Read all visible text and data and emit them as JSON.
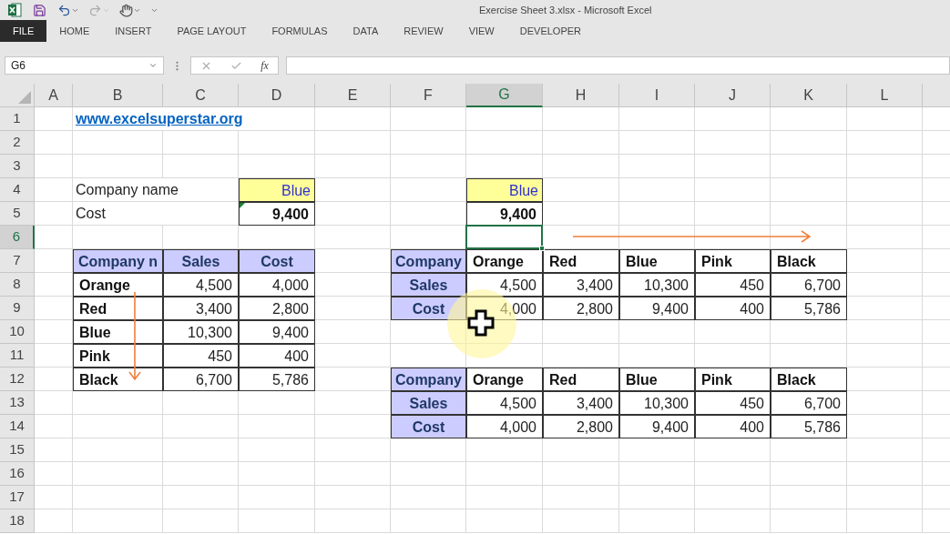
{
  "window": {
    "title": "Exercise Sheet 3.xlsx - Microsoft Excel"
  },
  "ribbon_tabs": [
    {
      "label": "FILE",
      "selected": true
    },
    {
      "label": "HOME",
      "selected": false
    },
    {
      "label": "INSERT",
      "selected": false
    },
    {
      "label": "PAGE LAYOUT",
      "selected": false
    },
    {
      "label": "FORMULAS",
      "selected": false
    },
    {
      "label": "DATA",
      "selected": false
    },
    {
      "label": "REVIEW",
      "selected": false
    },
    {
      "label": "VIEW",
      "selected": false
    },
    {
      "label": "DEVELOPER",
      "selected": false
    }
  ],
  "formula_bar": {
    "name_box": "G6",
    "function_label": "fx"
  },
  "columns": [
    {
      "label": "A",
      "selected": false
    },
    {
      "label": "B",
      "selected": false
    },
    {
      "label": "C",
      "selected": false
    },
    {
      "label": "D",
      "selected": false
    },
    {
      "label": "E",
      "selected": false
    },
    {
      "label": "F",
      "selected": false
    },
    {
      "label": "G",
      "selected": true
    },
    {
      "label": "H",
      "selected": false
    },
    {
      "label": "I",
      "selected": false
    },
    {
      "label": "J",
      "selected": false
    },
    {
      "label": "K",
      "selected": false
    },
    {
      "label": "L",
      "selected": false
    }
  ],
  "rows": [
    {
      "number": "1",
      "selected": false,
      "cells": [
        null,
        {
          "kind": "link",
          "text": "www.excelsuperstar.org"
        }
      ]
    },
    {
      "number": "2",
      "selected": false
    },
    {
      "number": "3",
      "selected": false
    },
    {
      "number": "4",
      "selected": false,
      "cells": [
        null,
        {
          "kind": "label",
          "text": "Company name"
        },
        null,
        {
          "kind": "input",
          "text": "Blue"
        },
        null,
        null,
        {
          "kind": "input",
          "text": "Blue"
        }
      ]
    },
    {
      "number": "5",
      "selected": false,
      "cells": [
        null,
        {
          "kind": "label",
          "text": "Cost"
        },
        null,
        {
          "kind": "total",
          "text": "9,400",
          "error_flag": true
        },
        null,
        null,
        {
          "kind": "total",
          "text": "9,400"
        }
      ]
    },
    {
      "number": "6",
      "selected": true
    },
    {
      "number": "7",
      "selected": false,
      "cells": [
        null,
        {
          "kind": "header",
          "text": "Company n"
        },
        {
          "kind": "header",
          "text": "Sales"
        },
        {
          "kind": "header",
          "text": "Cost"
        },
        null,
        {
          "kind": "header",
          "text": "Company"
        },
        {
          "kind": "name",
          "text": "Orange"
        },
        {
          "kind": "name",
          "text": "Red"
        },
        {
          "kind": "name",
          "text": "Blue"
        },
        {
          "kind": "name",
          "text": "Pink"
        },
        {
          "kind": "name",
          "text": "Black"
        }
      ]
    },
    {
      "number": "8",
      "selected": false,
      "cells": [
        null,
        {
          "kind": "name",
          "text": "Orange"
        },
        {
          "kind": "number",
          "text": "4,500"
        },
        {
          "kind": "number",
          "text": "4,000"
        },
        null,
        {
          "kind": "header",
          "text": "Sales"
        },
        {
          "kind": "number",
          "text": "4,500"
        },
        {
          "kind": "number",
          "text": "3,400"
        },
        {
          "kind": "number",
          "text": "10,300"
        },
        {
          "kind": "number",
          "text": "450"
        },
        {
          "kind": "number",
          "text": "6,700"
        }
      ]
    },
    {
      "number": "9",
      "selected": false,
      "cells": [
        null,
        {
          "kind": "name",
          "text": "Red"
        },
        {
          "kind": "number",
          "text": "3,400"
        },
        {
          "kind": "number",
          "text": "2,800"
        },
        null,
        {
          "kind": "header",
          "text": "Cost"
        },
        {
          "kind": "number",
          "text": "4,000"
        },
        {
          "kind": "number",
          "text": "2,800"
        },
        {
          "kind": "number",
          "text": "9,400"
        },
        {
          "kind": "number",
          "text": "400"
        },
        {
          "kind": "number",
          "text": "5,786"
        }
      ]
    },
    {
      "number": "10",
      "selected": false,
      "cells": [
        null,
        {
          "kind": "name",
          "text": "Blue"
        },
        {
          "kind": "number",
          "text": "10,300"
        },
        {
          "kind": "number",
          "text": "9,400"
        }
      ]
    },
    {
      "number": "11",
      "selected": false,
      "cells": [
        null,
        {
          "kind": "name",
          "text": "Pink"
        },
        {
          "kind": "number",
          "text": "450"
        },
        {
          "kind": "number",
          "text": "400"
        }
      ]
    },
    {
      "number": "12",
      "selected": false,
      "cells": [
        null,
        {
          "kind": "name",
          "text": "Black"
        },
        {
          "kind": "number",
          "text": "6,700"
        },
        {
          "kind": "number",
          "text": "5,786"
        },
        null,
        {
          "kind": "header",
          "text": "Company"
        },
        {
          "kind": "name",
          "text": "Orange"
        },
        {
          "kind": "name",
          "text": "Red"
        },
        {
          "kind": "name",
          "text": "Blue"
        },
        {
          "kind": "name",
          "text": "Pink"
        },
        {
          "kind": "name",
          "text": "Black"
        }
      ]
    },
    {
      "number": "13",
      "selected": false,
      "cells": [
        null,
        null,
        null,
        null,
        null,
        {
          "kind": "header",
          "text": "Sales"
        },
        {
          "kind": "number",
          "text": "4,500"
        },
        {
          "kind": "number",
          "text": "3,400"
        },
        {
          "kind": "number",
          "text": "10,300"
        },
        {
          "kind": "number",
          "text": "450"
        },
        {
          "kind": "number",
          "text": "6,700"
        }
      ]
    },
    {
      "number": "14",
      "selected": false,
      "cells": [
        null,
        null,
        null,
        null,
        null,
        {
          "kind": "header",
          "text": "Cost"
        },
        {
          "kind": "number",
          "text": "4,000"
        },
        {
          "kind": "number",
          "text": "2,800"
        },
        {
          "kind": "number",
          "text": "9,400"
        },
        {
          "kind": "number",
          "text": "400"
        },
        {
          "kind": "number",
          "text": "5,786"
        }
      ]
    },
    {
      "number": "15",
      "selected": false
    },
    {
      "number": "16",
      "selected": false
    },
    {
      "number": "17",
      "selected": false
    },
    {
      "number": "18",
      "selected": false
    }
  ]
}
